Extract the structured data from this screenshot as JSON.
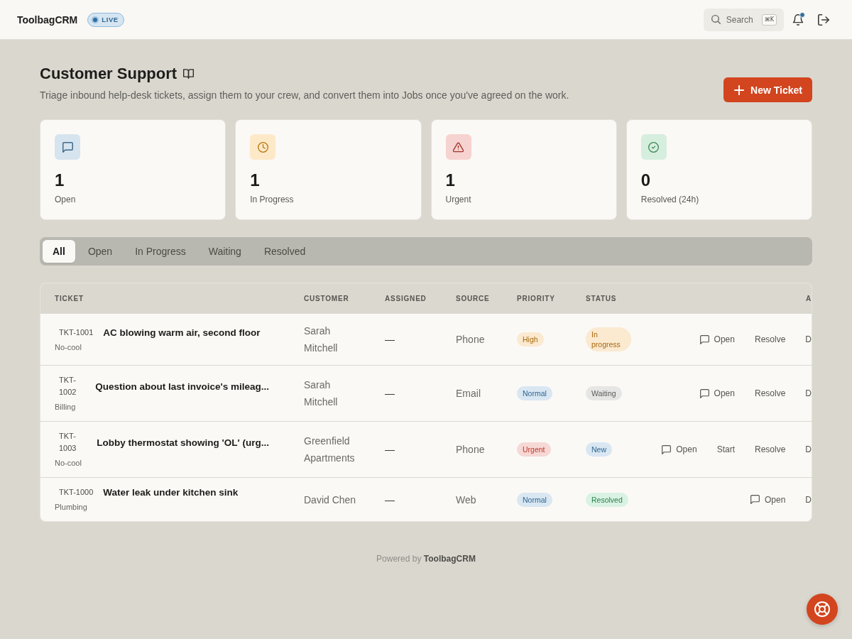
{
  "app": {
    "brand": "ToolbagCRM",
    "live_badge": "LIVE"
  },
  "header": {
    "search": {
      "label": "Search",
      "shortcut": "⌘K"
    },
    "notifications": {
      "unread": true
    }
  },
  "page": {
    "title": "Customer Support",
    "subtitle": "Triage inbound help-desk tickets, assign them to your crew, and convert them into Jobs once you've agreed on the work.",
    "primary_action": "New Ticket"
  },
  "stats": [
    {
      "value": "1",
      "label": "Open",
      "kind": "chat",
      "color": "#d6e4ef"
    },
    {
      "value": "1",
      "label": "In Progress",
      "kind": "clock",
      "color": "#fde9c8"
    },
    {
      "value": "1",
      "label": "Urgent",
      "kind": "warning",
      "color": "#f6d3d0"
    },
    {
      "value": "0",
      "label": "Resolved (24h)",
      "kind": "check",
      "color": "#d6eede"
    }
  ],
  "tabs": [
    {
      "label": "All",
      "selected": true
    },
    {
      "label": "Open",
      "selected": false
    },
    {
      "label": "In Progress",
      "selected": false
    },
    {
      "label": "Waiting",
      "selected": false
    },
    {
      "label": "Resolved",
      "selected": false
    }
  ],
  "table": {
    "columns": [
      "TICKET",
      "CUSTOMER",
      "ASSIGNED",
      "SOURCE",
      "PRIORITY",
      "STATUS",
      "A"
    ],
    "rows": [
      {
        "code": "TKT-1001",
        "category": "No-cool",
        "title": "AC blowing warm air, second floor",
        "customer": "Sarah Mitchell",
        "assigned": "—",
        "source": "Phone",
        "priority": {
          "label": "High",
          "color": "#a8690f"
        },
        "status": {
          "label": "In progress",
          "color": "#a8690f"
        },
        "actions": [
          {
            "label": "Open",
            "kind": "chat"
          },
          {
            "label": "Resolve",
            "kind": "text"
          },
          {
            "label": "D",
            "kind": "text"
          }
        ]
      },
      {
        "code": "TKT-1002",
        "category": "Billing",
        "title": "Question about last invoice's mileag...",
        "customer": "Sarah Mitchell",
        "assigned": "—",
        "source": "Email",
        "priority": {
          "label": "Normal",
          "color": "#2f6690"
        },
        "status": {
          "label": "Waiting",
          "color": "#5a5a55"
        },
        "actions": [
          {
            "label": "Open",
            "kind": "chat"
          },
          {
            "label": "Resolve",
            "kind": "text"
          },
          {
            "label": "D",
            "kind": "text"
          }
        ]
      },
      {
        "code": "TKT-1003",
        "category": "No-cool",
        "title": "Lobby thermostat showing 'OL' (urg...",
        "customer": "Greenfield Apartments",
        "assigned": "—",
        "source": "Phone",
        "priority": {
          "label": "Urgent",
          "color": "#c0392b"
        },
        "status": {
          "label": "New",
          "color": "#2f6690"
        },
        "actions": [
          {
            "label": "Open",
            "kind": "chat"
          },
          {
            "label": "Start",
            "kind": "text"
          },
          {
            "label": "Resolve",
            "kind": "text"
          },
          {
            "label": "D",
            "kind": "text"
          }
        ]
      },
      {
        "code": "TKT-1000",
        "category": "Plumbing",
        "title": "Water leak under kitchen sink",
        "customer": "David Chen",
        "assigned": "—",
        "source": "Web",
        "priority": {
          "label": "Normal",
          "color": "#2f6690"
        },
        "status": {
          "label": "Resolved",
          "color": "#2e8050"
        },
        "actions": [
          {
            "label": "Open",
            "kind": "chat"
          },
          {
            "label": "D",
            "kind": "text"
          }
        ]
      }
    ]
  },
  "footer": {
    "text": "Powered by **ToolbagCRM**"
  }
}
